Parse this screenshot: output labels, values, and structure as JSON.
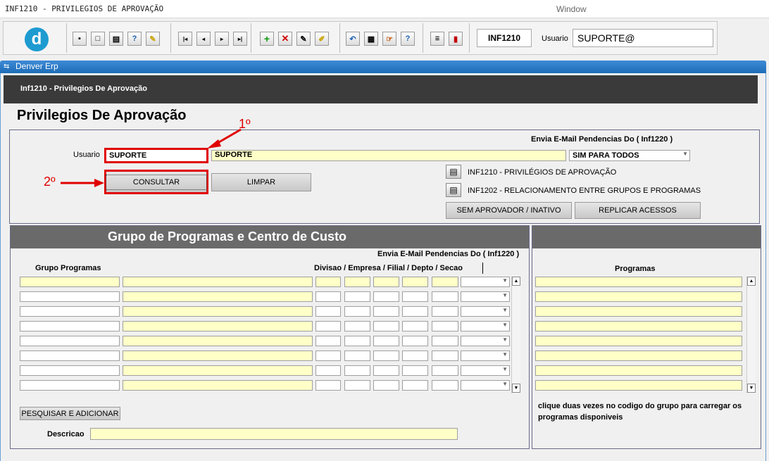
{
  "window": {
    "title": "INF1210 - PRIVILEGIOS DE APROVAÇÃO",
    "window_label": "Window"
  },
  "toolbar": {
    "logo": "d",
    "program_code": "INF1210",
    "user_label": "Usuario",
    "user_value": "SUPORTE@",
    "icons": [
      "save-icon",
      "window-icon",
      "print-icon",
      "help-query-icon",
      "edit-query-icon",
      "first-record-icon",
      "prev-record-icon",
      "next-record-icon",
      "last-record-icon",
      "insert-record-icon",
      "delete-record-icon",
      "edit-record-icon",
      "clear-record-icon",
      "undo-icon",
      "paste-icon",
      "tools-icon",
      "help-icon",
      "menu-icon",
      "exit-icon"
    ]
  },
  "app": {
    "header": "Denver Erp",
    "breadcrumb": "Inf1210 - Privilegios De Aprovação",
    "page_title": "Privilegios De Aprovação"
  },
  "form": {
    "email_header": "Envia E-Mail Pendencias Do ( Inf1220 )",
    "user_label": "Usuario",
    "user_code": "SUPORTE",
    "user_name": "SUPORTE",
    "email_select": "SIM PARA TODOS",
    "consultar": "CONSULTAR",
    "limpar": "LIMPAR",
    "report1": "INF1210 - PRIVILÉGIOS DE APROVAÇÃO",
    "report2": "INF1202 - RELACIONAMENTO ENTRE GRUPOS E PROGRAMAS",
    "sem_aprovador": "SEM APROVADOR / INATIVO",
    "replicar": "REPLICAR ACESSOS"
  },
  "annotations": {
    "step1": "1º",
    "step2": "2º"
  },
  "grupos": {
    "title": "Grupo de Programas e Centro de Custo",
    "email_header": "Envia E-Mail Pendencias Do ( Inf1220 )",
    "col_grupo": "Grupo Programas",
    "col_divisao": "Divisao / Empresa / Filial / Depto / Secao",
    "pesquisar": "PESQUISAR E ADICIONAR",
    "descricao_label": "Descricao"
  },
  "programas": {
    "col_label": "Programas",
    "hint": "clique duas vezes no codigo do grupo para carregar os programas disponiveis"
  }
}
